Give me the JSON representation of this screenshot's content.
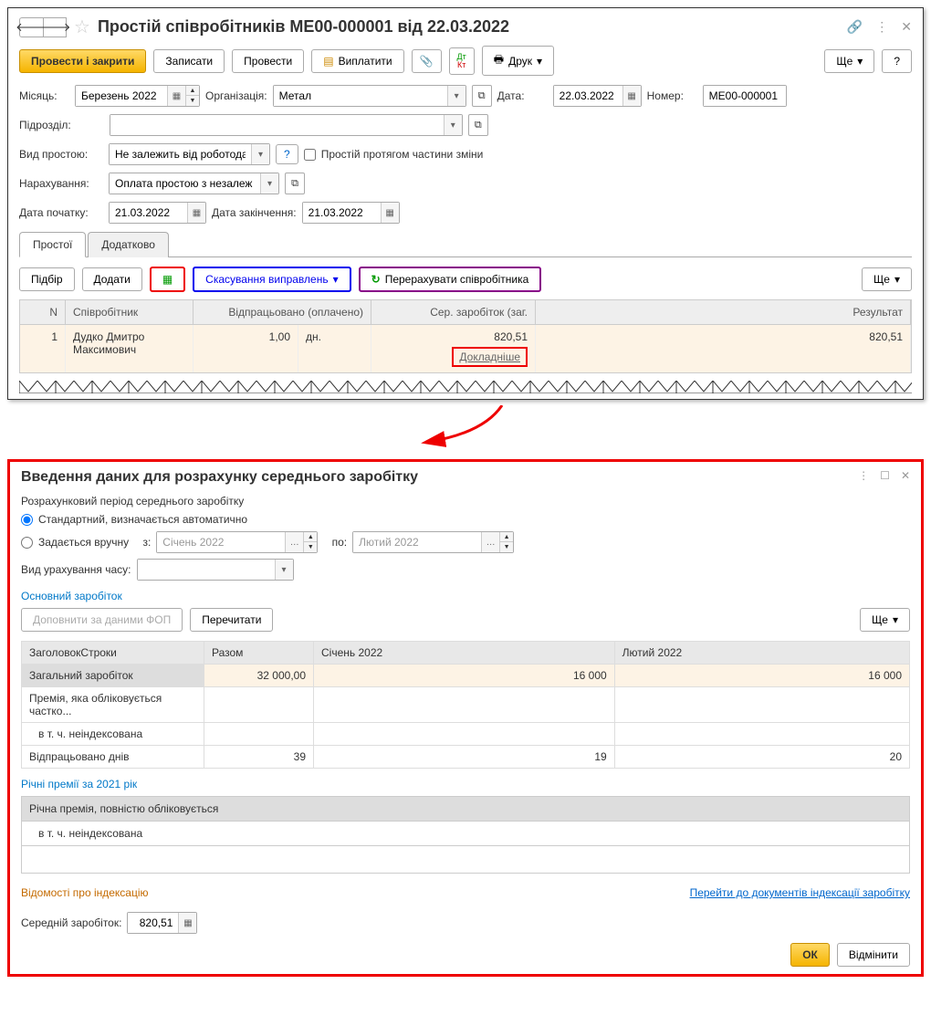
{
  "main": {
    "title": "Простій співробітників МЕ00-000001 від 22.03.2022",
    "toolbar": {
      "post_close": "Провести і закрити",
      "save": "Записати",
      "post": "Провести",
      "pay": "Виплатити",
      "print": "Друк",
      "more": "Ще",
      "help": "?"
    },
    "fields": {
      "month_label": "Місяць:",
      "month_value": "Березень 2022",
      "org_label": "Організація:",
      "org_value": "Метал",
      "date_label": "Дата:",
      "date_value": "22.03.2022",
      "number_label": "Номер:",
      "number_value": "МЕ00-000001",
      "dept_label": "Підрозділ:",
      "dept_value": "",
      "type_label": "Вид простою:",
      "type_value": "Не залежить від роботодав",
      "partial_shift": "Простій протягом частини зміни",
      "accrual_label": "Нарахування:",
      "accrual_value": "Оплата простою з незалеж",
      "start_label": "Дата початку:",
      "start_value": "21.03.2022",
      "end_label": "Дата закінчення:",
      "end_value": "21.03.2022"
    },
    "tabs": {
      "downtimes": "Простої",
      "additional": "Додатково"
    },
    "table_toolbar": {
      "select": "Підбір",
      "add": "Додати",
      "cancel_fixes": "Скасування виправлень",
      "recalc": "Перерахувати співробітника",
      "more": "Ще"
    },
    "table": {
      "head": {
        "n": "N",
        "emp": "Співробітник",
        "worked": "Відпрацьовано (оплачено)",
        "avg": "Сер. заробіток (заг.",
        "result": "Результат"
      },
      "row": {
        "n": "1",
        "emp": "Дудко Дмитро Максимович",
        "worked": "1,00",
        "unit": "дн.",
        "avg": "820,51",
        "result": "820,51",
        "detail": "Докладніше"
      }
    }
  },
  "modal": {
    "title": "Введення даних для розрахунку середнього заробітку",
    "period_label": "Розрахунковий період середнього заробітку",
    "radio_auto": "Стандартний, визначається автоматично",
    "radio_manual": "Задається вручну",
    "from_label": "з:",
    "from_value": "Січень 2022",
    "to_label": "по:",
    "to_value": "Лютий 2022",
    "time_calc_label": "Вид урахування часу:",
    "time_calc_value": "",
    "section_main": "Основний заробіток",
    "btn_fop": "Доповнити за даними ФОП",
    "btn_reread": "Перечитати",
    "btn_more": "Ще",
    "earnings_table": {
      "head": {
        "title": "ЗаголовокСтроки",
        "total": "Разом",
        "m1": "Січень 2022",
        "m2": "Лютий 2022"
      },
      "rows": [
        {
          "label": "Загальний заробіток",
          "total": "32 000,00",
          "m1": "16 000",
          "m2": "16 000",
          "sel": true
        },
        {
          "label": "Премія, яка обліковується частко...",
          "total": "",
          "m1": "",
          "m2": ""
        },
        {
          "label": "в т. ч. неіндексована",
          "total": "",
          "m1": "",
          "m2": "",
          "indent": true
        },
        {
          "label": "Відпрацьовано днів",
          "total": "39",
          "m1": "19",
          "m2": "20"
        }
      ]
    },
    "section_annual": "Річні премії за 2021 рік",
    "annual_row1": "Річна премія, повністю обліковується",
    "annual_row2": "в т. ч. неіндексована",
    "index_info": "Відомості про індексацію",
    "index_link": "Перейти до документів індексації заробітку",
    "avg_label": "Середній заробіток:",
    "avg_value": "820,51",
    "btn_ok": "ОК",
    "btn_cancel": "Відмінити"
  }
}
